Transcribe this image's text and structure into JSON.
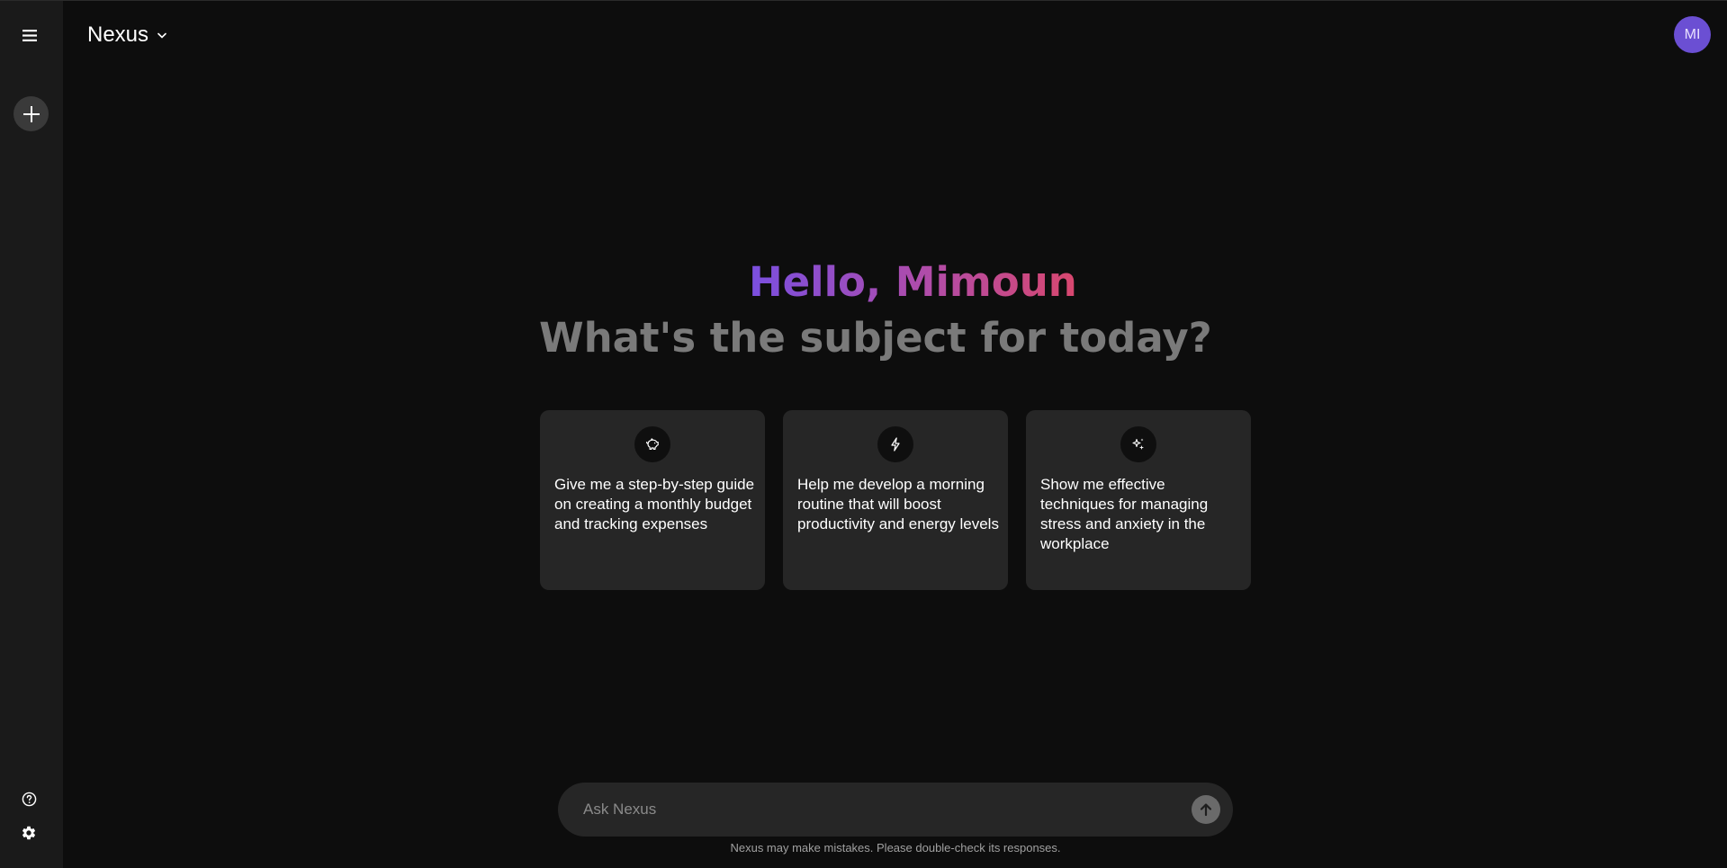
{
  "header": {
    "model_name": "Nexus",
    "avatar_initials": "MI"
  },
  "sidebar": {
    "menu_icon": "hamburger-menu-icon",
    "new_chat_icon": "plus-icon",
    "help_icon": "help-circle-icon",
    "settings_icon": "gear-icon"
  },
  "greeting": {
    "hello": "Hello, Mimoun",
    "subject": "What's the subject for today?"
  },
  "cards": [
    {
      "icon": "piggy-bank-icon",
      "text": "Give me a step-by-step guide on creating a monthly budget and tracking expenses"
    },
    {
      "icon": "lightning-icon",
      "text": "Help me develop a morning routine that will boost productivity and energy levels"
    },
    {
      "icon": "sparkles-icon",
      "text": "Show me effective techniques for managing stress and anxiety in the workplace"
    }
  ],
  "chat": {
    "placeholder": "Ask Nexus",
    "send_icon": "arrow-up-icon",
    "disclaimer": "Nexus may make mistakes. Please double-check its responses."
  },
  "colors": {
    "background": "#0d0d0d",
    "sidebar": "#1a1a1a",
    "card": "#262626",
    "avatar": "#6b4fd3",
    "greeting_gradient_start": "#7a4fe0",
    "greeting_gradient_end": "#d8476e",
    "subject_text": "#7a7a7a"
  }
}
